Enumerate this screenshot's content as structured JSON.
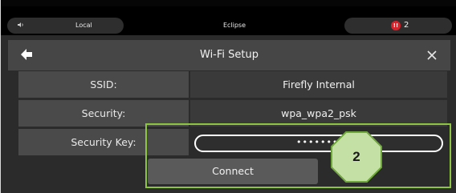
{
  "status_bar": {
    "left_icon": "speaker-volume-icon",
    "left_label": "Local",
    "center_label": "Eclipse",
    "alert_icon": "alert-badge-icon",
    "alert_count": "2"
  },
  "dialog": {
    "title": "Wi-Fi Setup",
    "back_icon": "back-arrow-icon",
    "close_icon": "close-icon",
    "rows": [
      {
        "label": "SSID:",
        "value": "Firefly Internal"
      },
      {
        "label": "Security:",
        "value": "wpa_wpa2_psk"
      },
      {
        "label": "Security Key:",
        "value": "••••••••"
      }
    ],
    "connect_label": "Connect"
  },
  "annotation": {
    "callout_label": "2",
    "color": "#8cc63f"
  }
}
